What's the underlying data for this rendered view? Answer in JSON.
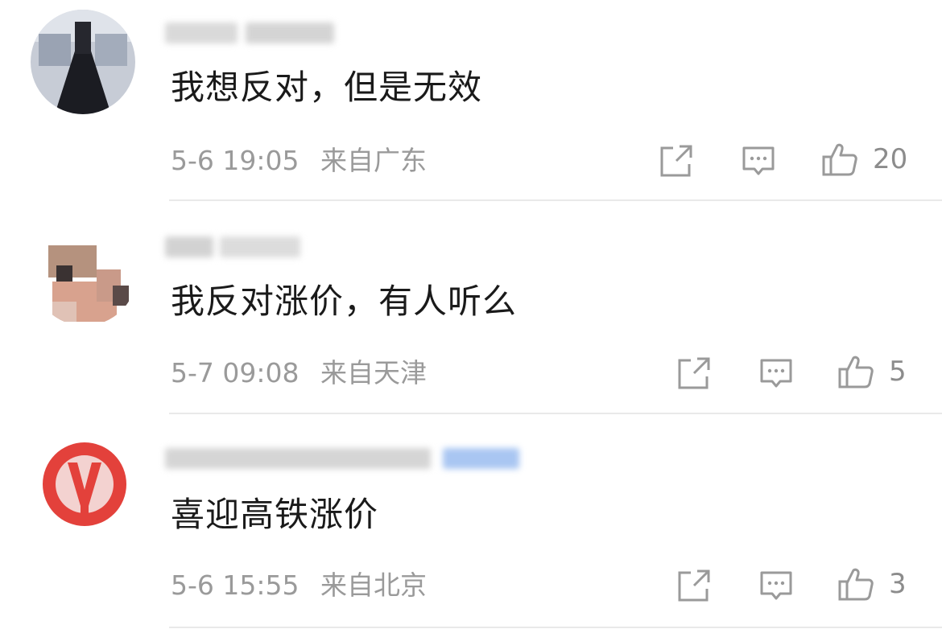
{
  "comments": [
    {
      "text": "我想反对，但是无效",
      "date": "5-6 19:05",
      "location": "来自广东",
      "likes": "20"
    },
    {
      "text": "我反对涨价，有人听么",
      "date": "5-7 09:08",
      "location": "来自天津",
      "likes": "5"
    },
    {
      "text": "喜迎高铁涨价",
      "date": "5-6 15:55",
      "location": "来自北京",
      "likes": "3"
    }
  ],
  "icons": {
    "share": "share-icon",
    "reply": "comment-icon",
    "like": "thumbs-up-icon"
  },
  "colors": {
    "text": "#1a1a1a",
    "meta": "#9a9a9a",
    "divider": "#e9e9e9",
    "badge": "#a9c6f2"
  }
}
